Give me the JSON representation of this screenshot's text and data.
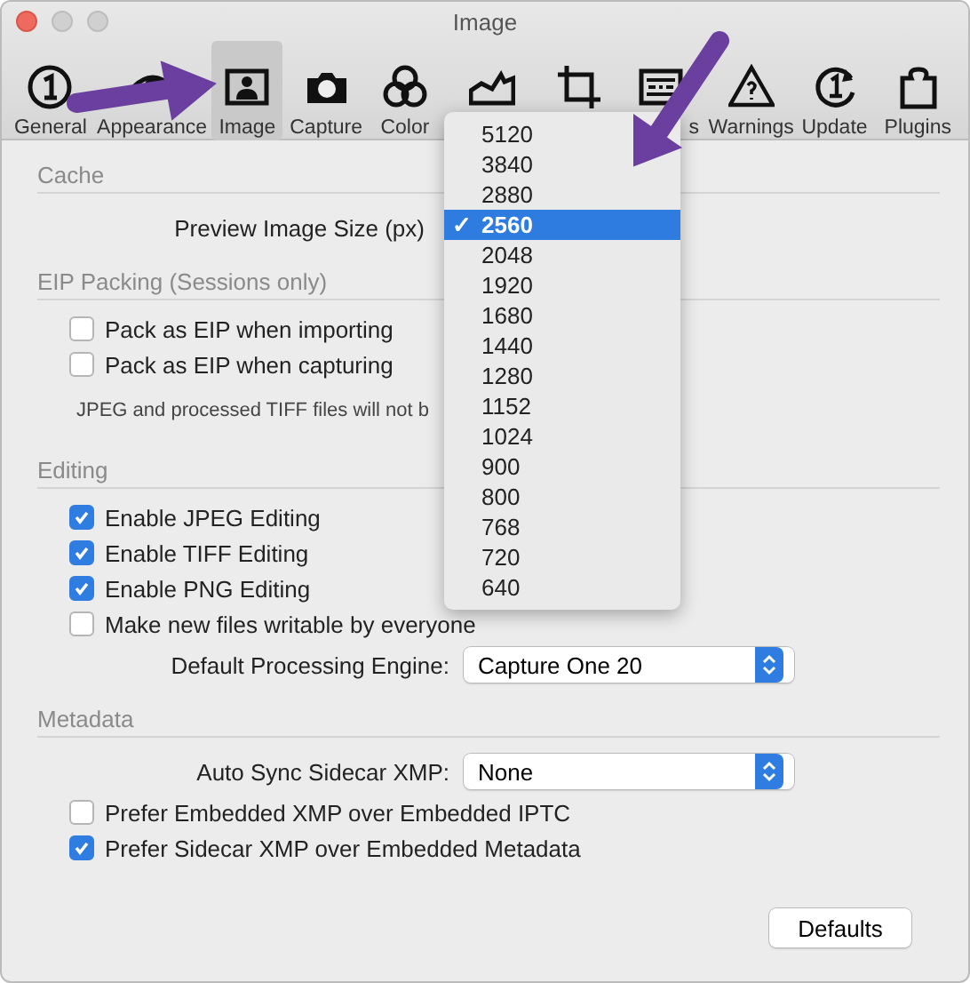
{
  "window": {
    "title": "Image"
  },
  "toolbar": [
    {
      "kind": "general",
      "label": "General",
      "selected": false
    },
    {
      "kind": "eye",
      "label": "Appearance",
      "selected": false
    },
    {
      "kind": "image",
      "label": "Image",
      "selected": true
    },
    {
      "kind": "camera",
      "label": "Capture",
      "selected": false
    },
    {
      "kind": "color",
      "selected": false,
      "label": "Color"
    },
    {
      "kind": "histogram",
      "selected": false
    },
    {
      "kind": "crop",
      "selected": false
    },
    {
      "kind": "grid",
      "label": "s",
      "selected": false
    },
    {
      "kind": "warning",
      "label": "Warnings",
      "selected": false
    },
    {
      "kind": "update",
      "label": "Update",
      "selected": false
    },
    {
      "kind": "plugin",
      "label": "Plugins",
      "selected": false
    }
  ],
  "sections": [
    {
      "title": "Cache",
      "rows": [
        {
          "kind": "popup",
          "label": "Preview Image Size (px)"
        }
      ]
    },
    {
      "title": "EIP Packing (Sessions only)",
      "rows": [
        {
          "kind": "checkbox",
          "label": "Pack as EIP when importing",
          "checked": false
        },
        {
          "kind": "checkbox",
          "label": "Pack as EIP when capturing",
          "checked": false
        },
        {
          "kind": "note",
          "label": "JPEG and processed TIFF files will not b"
        }
      ]
    },
    {
      "title": "Editing",
      "rows": [
        {
          "kind": "checkbox",
          "label": "Enable JPEG Editing",
          "checked": true
        },
        {
          "kind": "checkbox",
          "label": "Enable TIFF Editing",
          "checked": true
        },
        {
          "kind": "checkbox",
          "label": "Enable PNG Editing",
          "checked": true
        },
        {
          "kind": "checkbox",
          "label": "Make new files writable by everyone",
          "checked": false
        },
        {
          "kind": "popup",
          "label": "Default Processing Engine:",
          "value": "Capture One 20"
        }
      ]
    },
    {
      "title": "Metadata",
      "rows": [
        {
          "kind": "popup",
          "label": "Auto Sync Sidecar XMP:",
          "value": "None"
        },
        {
          "kind": "checkbox",
          "label": "Prefer Embedded XMP over Embedded IPTC",
          "checked": false
        },
        {
          "kind": "checkbox",
          "label": "Prefer Sidecar XMP over Embedded Metadata",
          "checked": true
        }
      ]
    }
  ],
  "menu": [
    {
      "label": "5120",
      "selected": false
    },
    {
      "label": "3840",
      "selected": false
    },
    {
      "label": "2880",
      "selected": false
    },
    {
      "label": "2560",
      "selected": true
    },
    {
      "label": "2048",
      "selected": false
    },
    {
      "label": "1920",
      "selected": false
    },
    {
      "label": "1680",
      "selected": false
    },
    {
      "label": "1440",
      "selected": false
    },
    {
      "label": "1280",
      "selected": false
    },
    {
      "label": "1152",
      "selected": false
    },
    {
      "label": "1024",
      "selected": false
    },
    {
      "label": "900",
      "selected": false
    },
    {
      "label": "800",
      "selected": false
    },
    {
      "label": "768",
      "selected": false
    },
    {
      "label": "720",
      "selected": false
    },
    {
      "label": "640",
      "selected": false
    }
  ],
  "menu_check": "✓",
  "buttons": [
    "Defaults"
  ]
}
